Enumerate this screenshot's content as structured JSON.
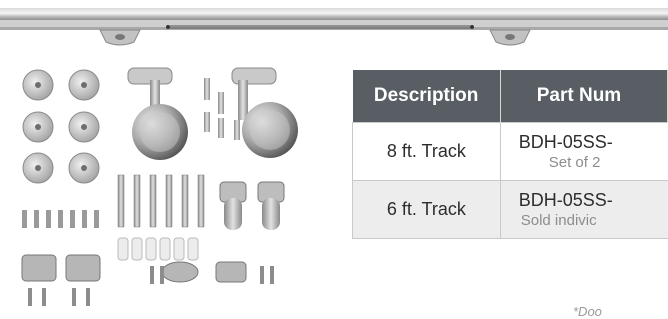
{
  "table": {
    "headers": [
      "Description",
      "Part Num"
    ],
    "rows": [
      {
        "description": "8 ft. Track",
        "part_number": "BDH-05SS-",
        "note": "Set of 2"
      },
      {
        "description": "6 ft. Track",
        "part_number": "BDH-05SS-",
        "note": "Sold indivic"
      }
    ]
  },
  "footnote": "*Doo",
  "colors": {
    "header_bg": "#585e63",
    "row_shade": "#ededed",
    "metal": "#b8b8b8"
  },
  "icons": [
    "barn-door-track-image",
    "hardware-kit-image"
  ]
}
